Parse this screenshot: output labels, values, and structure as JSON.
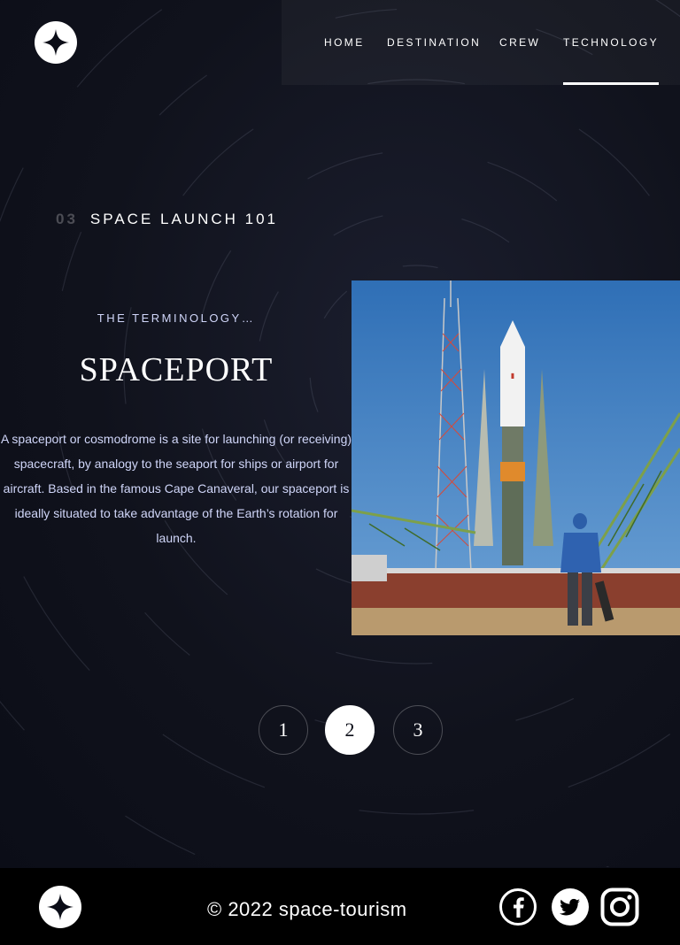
{
  "nav": {
    "items": [
      {
        "label": "HOME"
      },
      {
        "label": "DESTINATION"
      },
      {
        "label": "CREW"
      },
      {
        "label": "TECHNOLOGY"
      }
    ],
    "active": "TECHNOLOGY"
  },
  "section": {
    "number": "03",
    "title": "SPACE LAUNCH 101"
  },
  "technology": {
    "terminology": "THE TERMINOLOGY…",
    "name": "SPACEPORT",
    "description": "A spaceport or cosmodrome is a site for launching (or receiving) spacecraft, by analogy to the seaport for ships or airport for aircraft. Based in the famous Cape Canaveral, our spaceport is ideally situated to take advantage of the Earth’s rotation for launch."
  },
  "pagination": {
    "items": [
      "1",
      "2",
      "3"
    ],
    "active": "2"
  },
  "footer": {
    "copyright": "© 2022 space-tourism",
    "social": [
      "facebook-icon",
      "twitter-icon",
      "instagram-icon"
    ]
  },
  "colors": {
    "background": "#0b0d17",
    "text_secondary": "#d0d6f9",
    "sky": "#3f7fc1",
    "accent_white": "#ffffff"
  },
  "icons": {
    "logo": "four-point-star-logo"
  }
}
